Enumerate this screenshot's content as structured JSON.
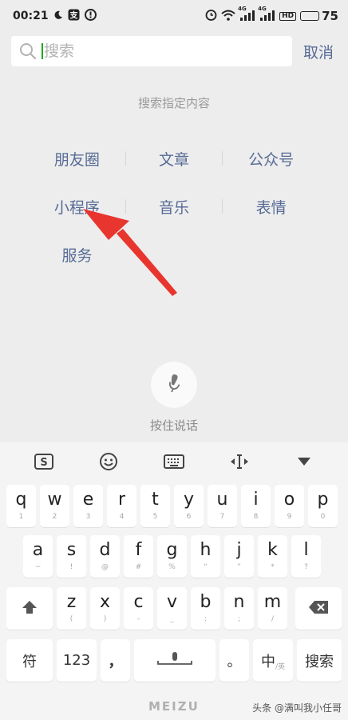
{
  "status_bar": {
    "time": "00:21",
    "battery_level": "75",
    "battery_fraction": 0.75,
    "network_labels": [
      "4G",
      "4G"
    ],
    "hd_label": "HD",
    "icons": [
      "moon-icon",
      "alipay-icon",
      "notification-icon",
      "alarm-icon",
      "wifi-icon",
      "signal-icon",
      "signal-icon",
      "hd-icon",
      "battery-icon"
    ]
  },
  "search": {
    "placeholder": "搜索",
    "cancel_label": "取消"
  },
  "hint": {
    "title": "搜索指定内容"
  },
  "categories": [
    [
      "朋友圈",
      "文章",
      "公众号"
    ],
    [
      "小程序",
      "音乐",
      "表情"
    ],
    [
      "服务"
    ]
  ],
  "voice": {
    "label": "按住说话"
  },
  "keyboard": {
    "toolbar_icons": [
      "sogou-icon",
      "emoji-icon",
      "keyboard-icon",
      "cursor-icon",
      "collapse-icon"
    ],
    "row1": [
      {
        "k": "q",
        "s": "1"
      },
      {
        "k": "w",
        "s": "2"
      },
      {
        "k": "e",
        "s": "3"
      },
      {
        "k": "r",
        "s": "4"
      },
      {
        "k": "t",
        "s": "5"
      },
      {
        "k": "y",
        "s": "6"
      },
      {
        "k": "u",
        "s": "7"
      },
      {
        "k": "i",
        "s": "8"
      },
      {
        "k": "o",
        "s": "9"
      },
      {
        "k": "p",
        "s": "0"
      }
    ],
    "row2": [
      {
        "k": "a",
        "s": "~"
      },
      {
        "k": "s",
        "s": "!"
      },
      {
        "k": "d",
        "s": "@"
      },
      {
        "k": "f",
        "s": "#"
      },
      {
        "k": "g",
        "s": "%"
      },
      {
        "k": "h",
        "s": "“"
      },
      {
        "k": "j",
        "s": "”"
      },
      {
        "k": "k",
        "s": "*"
      },
      {
        "k": "l",
        "s": "?"
      }
    ],
    "row3": [
      {
        "k": "z",
        "s": "("
      },
      {
        "k": "x",
        "s": ")"
      },
      {
        "k": "c",
        "s": "-"
      },
      {
        "k": "v",
        "s": "_"
      },
      {
        "k": "b",
        "s": ":"
      },
      {
        "k": "n",
        "s": ";"
      },
      {
        "k": "m",
        "s": "/"
      }
    ],
    "row4": {
      "symbol": "符",
      "numbers": "123",
      "comma": "，",
      "period": "。",
      "lang_main": "中",
      "lang_sub": "/英",
      "search": "搜索"
    }
  },
  "footer": {
    "brand": "MEIZU",
    "watermark": "头条 @满叫我小任哥"
  },
  "colors": {
    "link_blue": "#576b95",
    "battery_yellow": "#f2c400",
    "arrow_red": "#e8352e",
    "cursor_green": "#1aad19"
  }
}
